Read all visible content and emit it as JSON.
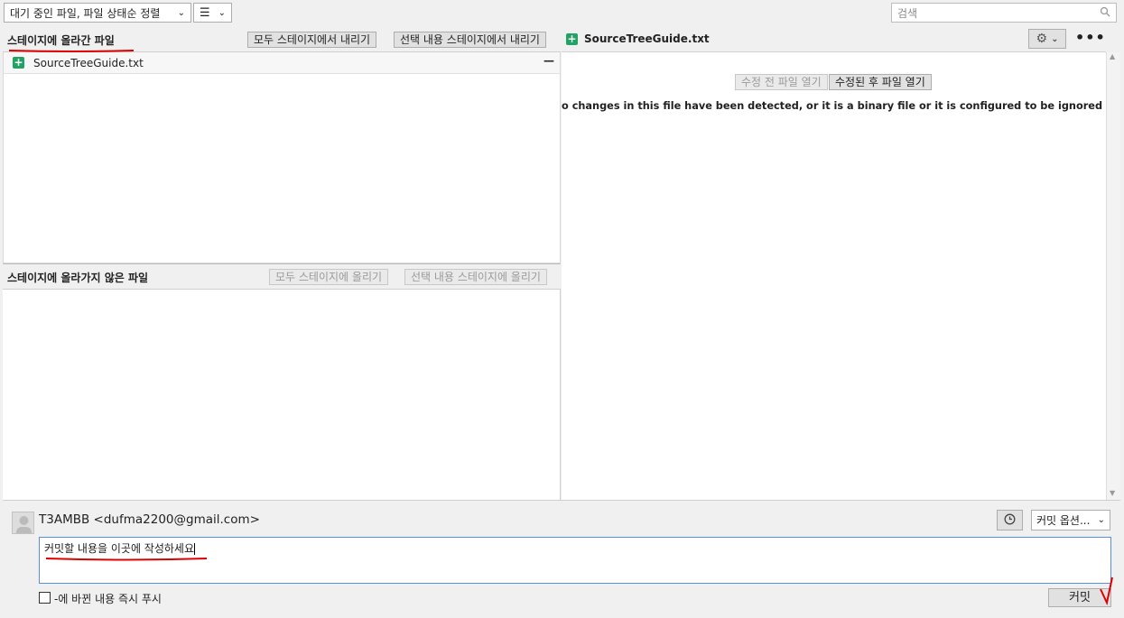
{
  "toolbar": {
    "sort_label": "대기 중인 파일, 파일 상태순 정렬",
    "view_icon": "list-icon",
    "search_placeholder": "검색"
  },
  "staged": {
    "title": "스테이지에 올라간 파일",
    "unstage_all": "모두 스테이지에서 내리기",
    "unstage_selected": "선택 내용 스테이지에서 내리기",
    "files": [
      {
        "name": "SourceTreeGuide.txt",
        "status_icon": "added-plus-icon"
      }
    ]
  },
  "unstaged": {
    "title": "스테이지에 올라가지 않은 파일",
    "stage_all": "모두 스테이지에 올리기",
    "stage_selected": "선택 내용 스테이지에 올리기"
  },
  "diff": {
    "file_name": "SourceTreeGuide.txt",
    "open_before": "수정 전 파일 열기",
    "open_after": "수정된 후 파일 열기",
    "message": "o changes in this file have been detected, or it is a binary file or it is configured to be ignored by the file pattern"
  },
  "commit": {
    "author": "T3AMBB <dufma2200@gmail.com>",
    "message": "커밋할 내용을 이곳에 작성하세요",
    "options_label": "커밋 옵션...",
    "push_label": "-에 바뀐 내용 즉시 푸시",
    "commit_button": "커밋"
  },
  "colors": {
    "accent_red": "#e00000",
    "added_green": "#21a366",
    "focus_blue": "#5a8fd6"
  }
}
